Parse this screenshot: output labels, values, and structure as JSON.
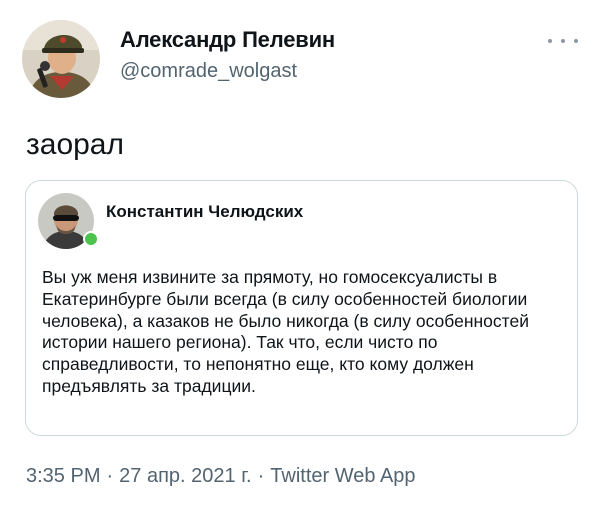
{
  "tweet": {
    "author": {
      "name": "Александр Пелевин",
      "handle": "@comrade_wolgast"
    },
    "text": "заорал",
    "quoted": {
      "author": {
        "name": "Константин Челюдских",
        "online": true
      },
      "text": "Вы уж меня извините за прямоту, но гомосексуалисты в Екатеринбурге были всегда (в силу особенностей биологии человека), а казаков не было никогда (в силу особенностей истории нашего региона). Так что, если чисто по справедливости, то непонятно еще, кто кому должен предъявлять за традиции."
    },
    "meta": {
      "time": "3:35 PM",
      "date": "27 апр. 2021 г.",
      "separator": "·",
      "source": "Twitter Web App"
    }
  },
  "icons": {
    "more": "more-horizontal-icon"
  },
  "colors": {
    "text": "#0f1419",
    "secondary": "#536471",
    "border": "#cfd9de",
    "online": "#4cc44c"
  }
}
